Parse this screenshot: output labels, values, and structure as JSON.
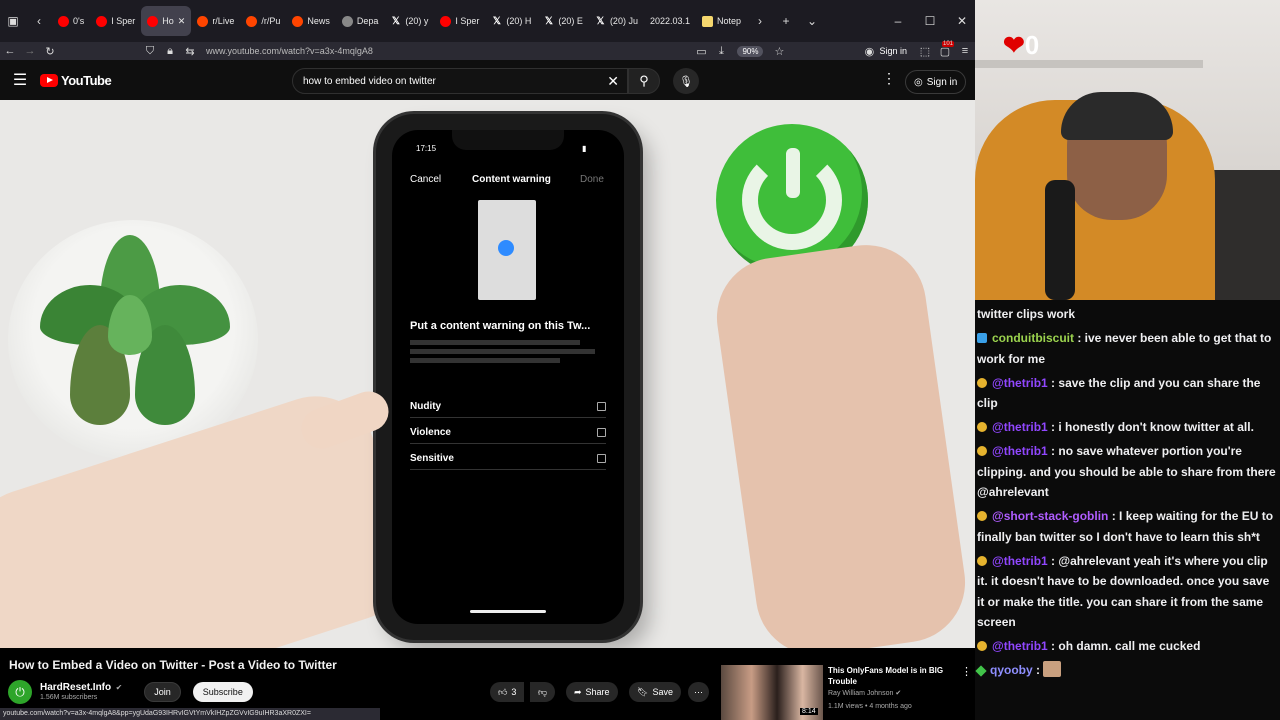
{
  "browser": {
    "tabs": [
      {
        "label": "0's",
        "icon": "youtube"
      },
      {
        "label": "I Sper",
        "icon": "youtube"
      },
      {
        "label": "Ho",
        "icon": "youtube",
        "active": true
      },
      {
        "label": "r/Live",
        "icon": "reddit"
      },
      {
        "label": "/r/Pu",
        "icon": "reddit"
      },
      {
        "label": "News",
        "icon": "reddit"
      },
      {
        "label": "Depa",
        "icon": "generic"
      },
      {
        "label": "(20) y",
        "icon": "x"
      },
      {
        "label": "I Sper",
        "icon": "youtube"
      },
      {
        "label": "(20) H",
        "icon": "x"
      },
      {
        "label": "(20) E",
        "icon": "x"
      },
      {
        "label": "(20) Ju",
        "icon": "x"
      },
      {
        "label": "2022.03.1",
        "icon": "none"
      },
      {
        "label": "Notep",
        "icon": "note"
      }
    ],
    "url": "www.youtube.com/watch?v=a3x-4mqlgA8",
    "zoom": "90%",
    "signin": "Sign in",
    "badge_count": "101"
  },
  "youtube": {
    "logo_text": "YouTube",
    "search_value": "how to embed video on twitter",
    "signin": "Sign in"
  },
  "phone": {
    "time": "17:15",
    "cancel": "Cancel",
    "header": "Content warning",
    "done": "Done",
    "warning_title": "Put a content warning on this Tw...",
    "options": [
      "Nudity",
      "Violence",
      "Sensitive"
    ]
  },
  "video": {
    "title": "How to Embed a Video on Twitter - Post a Video to Twitter",
    "channel": "HardReset.Info",
    "subscribers": "1.56M subscribers",
    "join": "Join",
    "subscribe": "Subscribe",
    "likes": "3",
    "share": "Share",
    "save": "Save"
  },
  "status_url": "youtube.com/watch?v=a3x-4mqlgA8&pp=ygUdaG93IHRvIGVtYmVkIHZpZGVvIG9uIHR3aXR0ZXI=",
  "recommendation": {
    "title": "This OnlyFans Model is in BIG Trouble",
    "channel": "Ray William Johnson",
    "meta": "1.1M views • 4 months ago",
    "duration": "8:14"
  },
  "stream": {
    "counter": "0"
  },
  "chat": [
    {
      "user": "",
      "text": "twitter clips work",
      "badge": "none"
    },
    {
      "user": "conduitbiscuit",
      "text": "ive never been able to get that to work for me",
      "badge": "blue",
      "cls": "cb"
    },
    {
      "user": "@thetrib1",
      "text": "save the clip and you can share the clip",
      "badge": "gold",
      "cls": ""
    },
    {
      "user": "@thetrib1",
      "text": "i honestly don't know twitter at all.",
      "badge": "gold",
      "cls": ""
    },
    {
      "user": "@thetrib1",
      "text": "no save whatever portion you're clipping. and you should be able to share from there @ahrelevant",
      "badge": "gold",
      "cls": ""
    },
    {
      "user": "@short-stack-goblin",
      "text": "I keep waiting for the EU to finally ban twitter so I don't have to learn this sh*t",
      "badge": "gold",
      "cls": "sg"
    },
    {
      "user": "@thetrib1",
      "text": "@ahrelevant yeah it's where you clip it. it doesn't have to be downloaded. once you save it or make the title. you can share it from the same screen",
      "badge": "gold",
      "cls": ""
    },
    {
      "user": "@thetrib1",
      "text": "oh damn. call me cucked",
      "badge": "gold",
      "cls": ""
    },
    {
      "user": "qyooby",
      "text": "",
      "badge": "green",
      "cls": "qy",
      "emote": true
    }
  ]
}
